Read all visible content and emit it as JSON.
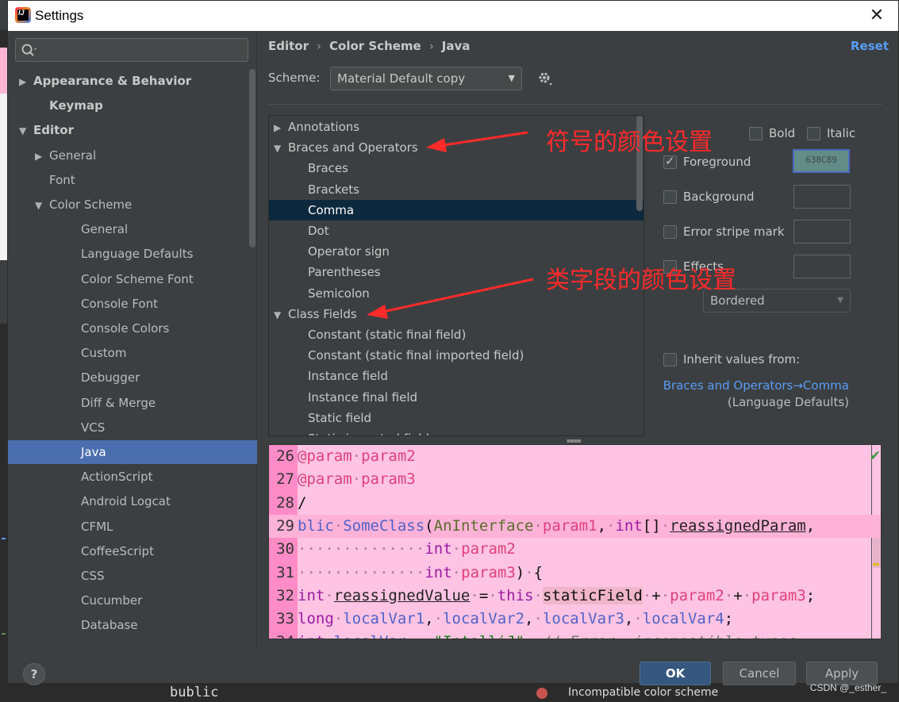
{
  "window": {
    "title": "Settings",
    "close_label": "✕"
  },
  "search": {
    "icon": "search-icon"
  },
  "tree": [
    {
      "label": "Appearance & Behavior",
      "arrow": "▶",
      "bold": true
    },
    {
      "label": "Keymap",
      "arrow": "",
      "bold": true
    },
    {
      "label": "Editor",
      "arrow": "▼",
      "bold": true
    },
    {
      "label": "General",
      "arrow": "▶"
    },
    {
      "label": "Font",
      "arrow": ""
    },
    {
      "label": "Color Scheme",
      "arrow": "▼"
    },
    {
      "label": "General",
      "arrow": ""
    },
    {
      "label": "Language Defaults",
      "arrow": ""
    },
    {
      "label": "Color Scheme Font",
      "arrow": ""
    },
    {
      "label": "Console Font",
      "arrow": ""
    },
    {
      "label": "Console Colors",
      "arrow": ""
    },
    {
      "label": "Custom",
      "arrow": ""
    },
    {
      "label": "Debugger",
      "arrow": ""
    },
    {
      "label": "Diff & Merge",
      "arrow": ""
    },
    {
      "label": "VCS",
      "arrow": ""
    },
    {
      "label": "Java",
      "arrow": "",
      "selected": true
    },
    {
      "label": "ActionScript",
      "arrow": ""
    },
    {
      "label": "Android Logcat",
      "arrow": ""
    },
    {
      "label": "CFML",
      "arrow": ""
    },
    {
      "label": "CoffeeScript",
      "arrow": ""
    },
    {
      "label": "CSS",
      "arrow": ""
    },
    {
      "label": "Cucumber",
      "arrow": ""
    },
    {
      "label": "Database",
      "arrow": ""
    }
  ],
  "breadcrumb": {
    "a": "Editor",
    "b": "Color Scheme",
    "c": "Java",
    "sep": "›"
  },
  "reset_label": "Reset",
  "scheme": {
    "label": "Scheme:",
    "value": "Material Default copy"
  },
  "elements": [
    {
      "label": "Annotations",
      "arrow": "▶",
      "level": 0
    },
    {
      "label": "Braces and Operators",
      "arrow": "▼",
      "level": 0
    },
    {
      "label": "Braces",
      "level": 1
    },
    {
      "label": "Brackets",
      "level": 1
    },
    {
      "label": "Comma",
      "level": 1,
      "selected": true
    },
    {
      "label": "Dot",
      "level": 1
    },
    {
      "label": "Operator sign",
      "level": 1
    },
    {
      "label": "Parentheses",
      "level": 1
    },
    {
      "label": "Semicolon",
      "level": 1
    },
    {
      "label": "Class Fields",
      "arrow": "▼",
      "level": 0
    },
    {
      "label": "Constant (static final field)",
      "level": 1
    },
    {
      "label": "Constant (static final imported field)",
      "level": 1
    },
    {
      "label": "Instance field",
      "level": 1
    },
    {
      "label": "Instance final field",
      "level": 1
    },
    {
      "label": "Static field",
      "level": 1
    },
    {
      "label": "Static imported field",
      "level": 1
    }
  ],
  "attributes": {
    "bold": "Bold",
    "italic": "Italic",
    "foreground": "Foreground",
    "foreground_value": "638C89",
    "background": "Background",
    "error_stripe": "Error stripe mark",
    "effects": "Effects",
    "effects_type": "Bordered",
    "inherit": "Inherit values from:",
    "inherit_link": "Braces and Operators→Comma",
    "inherit_note": "(Language Defaults)"
  },
  "annotations": {
    "symbol_color": "符号的颜色设置",
    "class_field_color": "类字段的颜色设置"
  },
  "preview_lines": [
    {
      "n": "26",
      "t": "@param.param2"
    },
    {
      "n": "27",
      "t": "@param.param3"
    },
    {
      "n": "28",
      "t": "/"
    },
    {
      "n": "29",
      "t": "blic.SomeClass(AnInterface.param1,.int[].reassignedParam,"
    },
    {
      "n": "30",
      "t": "..............int.param2"
    },
    {
      "n": "31",
      "t": "..............int.param3).{"
    },
    {
      "n": "32",
      "t": "int.reassignedValue.=.this.staticField.+.param2.+.param3;"
    },
    {
      "n": "33",
      "t": "long.localVar1,.localVar2,.localVar3,.localVar4;"
    },
    {
      "n": "34",
      "t": "int.localVar.=.\"IntelliJ\";.//.Error,.incompatible.types"
    }
  ],
  "buttons": {
    "help": "?",
    "ok": "OK",
    "cancel": "Cancel",
    "apply": "Apply"
  },
  "watermark": "CSDN @_esther_",
  "background_window": {
    "code_fragment": "bublic",
    "status_text": "Incompatible color scheme"
  },
  "colors": {
    "accent_link": "#589df6",
    "selected_tree": "#4b6eaf",
    "selected_element": "#0d293e",
    "foreground_swatch": "#638c89",
    "preview_bg": "#ffc4e3",
    "annotation": "#ff2a2a"
  }
}
